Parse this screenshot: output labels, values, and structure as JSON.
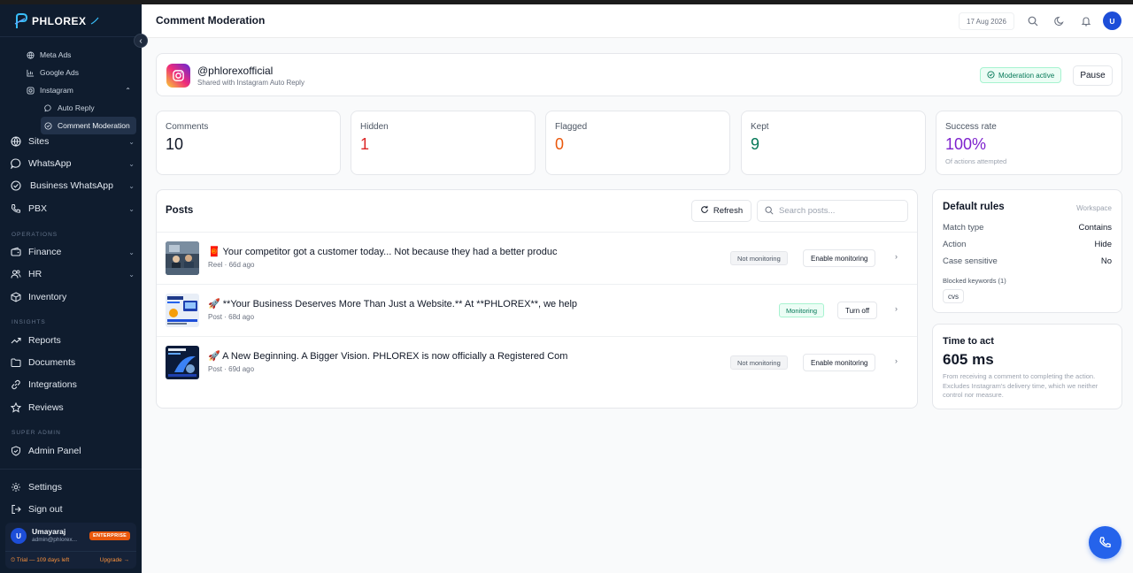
{
  "app": {
    "logo_text": "PHLOREX"
  },
  "sidebar": {
    "sub_items": [
      {
        "label": "Meta Ads"
      },
      {
        "label": "Google Ads"
      },
      {
        "label": "Instagram"
      }
    ],
    "instagram_children": [
      {
        "label": "Auto Reply"
      },
      {
        "label": "Comment Moderation"
      }
    ],
    "items": [
      {
        "label": "Sites"
      },
      {
        "label": "WhatsApp"
      },
      {
        "label": "Business WhatsApp"
      },
      {
        "label": "PBX"
      }
    ],
    "sections": {
      "operations": "OPERATIONS",
      "insights": "INSIGHTS",
      "super_admin": "SUPER ADMIN"
    },
    "operations_items": [
      {
        "label": "Finance"
      },
      {
        "label": "HR"
      },
      {
        "label": "Inventory"
      }
    ],
    "insights_items": [
      {
        "label": "Reports"
      },
      {
        "label": "Documents"
      },
      {
        "label": "Integrations"
      },
      {
        "label": "Reviews"
      }
    ],
    "admin_items": [
      {
        "label": "Admin Panel"
      }
    ],
    "bottom_items": [
      {
        "label": "Settings"
      },
      {
        "label": "Sign out"
      }
    ],
    "user": {
      "initial": "U",
      "name": "Umayaraj",
      "email": "admin@phlorex...",
      "plan": "ENTERPRISE",
      "trial": "⏲ Trial — 109 days left",
      "upgrade": "Upgrade →"
    }
  },
  "header": {
    "title": "Comment Moderation",
    "date": "17 Aug 2026",
    "avatar_initial": "U"
  },
  "account": {
    "handle": "@phlorexofficial",
    "subtitle": "Shared with Instagram Auto Reply",
    "status": "Moderation active",
    "pause_label": "Pause"
  },
  "stats": [
    {
      "label": "Comments",
      "value": "10",
      "color": "#111827"
    },
    {
      "label": "Hidden",
      "value": "1",
      "color": "#dc2626"
    },
    {
      "label": "Flagged",
      "value": "0",
      "color": "#ea580c"
    },
    {
      "label": "Kept",
      "value": "9",
      "color": "#047857"
    },
    {
      "label": "Success rate",
      "value": "100%",
      "color": "#7e22ce",
      "note": "Of actions attempted"
    }
  ],
  "posts": {
    "title": "Posts",
    "refresh_label": "Refresh",
    "search_placeholder": "Search posts...",
    "rows": [
      {
        "title": "🧧 Your competitor got a customer today... Not because they had a better produc",
        "meta": "Reel · 66d ago",
        "status": "Not monitoring",
        "action": "Enable monitoring"
      },
      {
        "title": "🚀 **Your Business Deserves More Than Just a Website.** At **PHLOREX**, we help",
        "meta": "Post · 68d ago",
        "status": "Monitoring",
        "action": "Turn off"
      },
      {
        "title": "🚀 A New Beginning. A Bigger Vision. PHLOREX is now officially a Registered Com",
        "meta": "Post · 69d ago",
        "status": "Not monitoring",
        "action": "Enable monitoring"
      }
    ]
  },
  "rules": {
    "title": "Default rules",
    "scope": "Workspace",
    "items": [
      {
        "key": "Match type",
        "value": "Contains"
      },
      {
        "key": "Action",
        "value": "Hide"
      },
      {
        "key": "Case sensitive",
        "value": "No"
      }
    ],
    "keywords_label": "Blocked keywords (1)",
    "keywords": [
      "cvs"
    ]
  },
  "time_to_act": {
    "title": "Time to act",
    "value": "605 ms",
    "description": "From receiving a comment to completing the action. Excludes Instagram's delivery time, which we neither control nor measure."
  }
}
